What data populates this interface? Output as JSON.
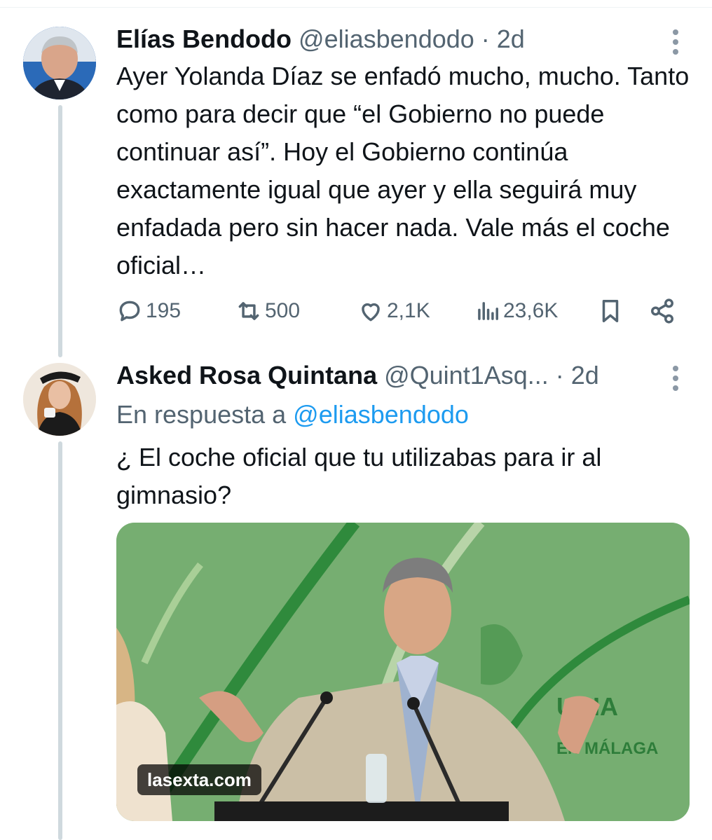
{
  "tweet1": {
    "author_name": "Elías Bendodo",
    "author_handle": "@eliasbendodo",
    "time": "· 2d",
    "text": "Ayer Yolanda Díaz se enfadó mucho, mucho. Tanto como para decir que “el Gobierno no puede continuar así”. Hoy el Gobierno continúa exactamente igual que ayer y ella seguirá muy enfadada pero sin hacer nada. Vale más el coche oficial…",
    "replies": "195",
    "reposts": "500",
    "likes": "2,1K",
    "views": "23,6K",
    "icons": [
      "reply-icon",
      "repost-icon",
      "like-icon",
      "views-icon",
      "bookmark-icon",
      "share-icon",
      "more-icon"
    ]
  },
  "tweet2": {
    "author_name": "Asked Rosa Quintana",
    "author_handle": "@Quint1Asq...",
    "time": "· 2d",
    "reply_prefix": "En respuesta a ",
    "reply_mention": "@eliasbendodo",
    "text": "¿ El coche oficial que tu utilizabas para ir al gimnasio?",
    "media_source": "lasexta.com",
    "media_sign_text": "EN MÁLAGA",
    "media_sign_partial": "UCIA"
  },
  "colors": {
    "text": "#0f1419",
    "secondary": "#536471",
    "link": "#1d9bf0",
    "thread_line": "#cfd9de",
    "media_background": "#6fa86a"
  }
}
